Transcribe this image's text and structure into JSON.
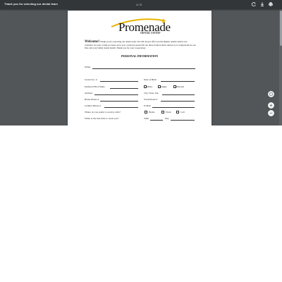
{
  "toolbar": {
    "title": "Thank you for selecting our dental team",
    "page_indicator": "1 / 3",
    "rotate_icon": "rotate-icon",
    "download_icon": "download-icon",
    "print_icon": "print-icon"
  },
  "document": {
    "logo": {
      "word": "Promenade",
      "sub": "dental center"
    },
    "welcome_heading": "Welcome!",
    "welcome_text": "Thank you for selecting our dental team. We will always offer you the highest quality dental care available. In order to help us better serve you, could you please fill out these forms in their entirety as it is important for our files and your family dental health. Thank you for your cooperation.",
    "section_title": "PERSONAL INFORMATION",
    "fields": {
      "name": "Name",
      "ssn": "Social Sec. #",
      "dob": "Date of Birth",
      "preferred_name": "Preferred First Name",
      "minor": "Minor",
      "single": "Single",
      "married": "Married",
      "address": "Address",
      "city_state_zip": "City, State, Zip",
      "home_phone": "Home Phone #",
      "work_phone": "Work Phone #",
      "cell_phone": "Cellular Phone #",
      "email": "E-Mail",
      "prefer_call": "Where do you prefer to receive calls?",
      "opt_home": "Home",
      "opt_work": "Work",
      "opt_cell": "Cell",
      "best_time": "When is the best time to reach you?",
      "time": "Time",
      "day": "Day"
    }
  },
  "zoom": {
    "fit_icon": "fit-page-icon",
    "zoom_in_icon": "zoom-in-icon",
    "zoom_out_icon": "zoom-out-icon"
  },
  "colors": {
    "toolbar": "#323639",
    "viewer_bg": "#525659",
    "logo_accent": "#e8b400"
  }
}
